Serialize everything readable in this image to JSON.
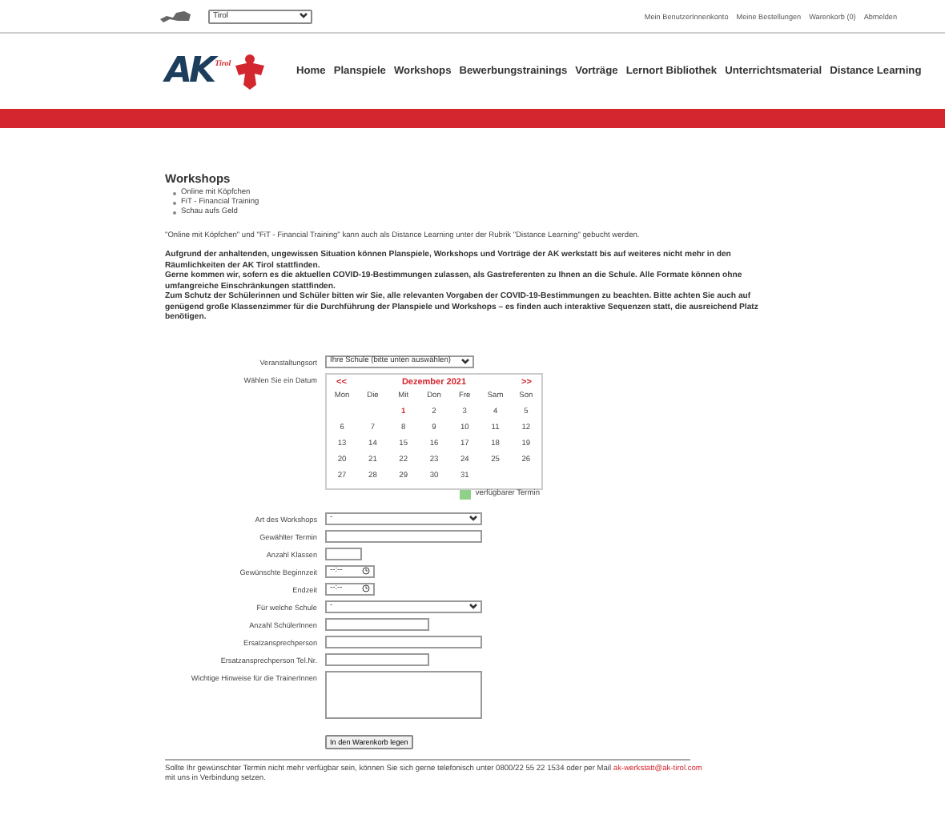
{
  "top_bar": {
    "region_select": {
      "value": "Tirol"
    },
    "links": [
      "Mein BenutzerInnenkonto",
      "Meine Bestellungen",
      "Warenkorb (0)",
      "Abmelden"
    ]
  },
  "logo": {
    "letters": "AK",
    "sub": "Tirol"
  },
  "nav": [
    "Home",
    "Planspiele",
    "Workshops",
    "Bewerbungstrainings",
    "Vorträge",
    "Lernort Bibliothek",
    "Unterrichtsmaterial",
    "Distance Learning"
  ],
  "heading": "Workshops",
  "workshops": [
    "Online mit Köpfchen",
    "FiT - Financial Training",
    "Schau aufs Geld"
  ],
  "note": "\"Online mit Köpfchen\" und \"FiT - Financial Training\" kann auch als Distance Learning unter der Rubrik \"Distance Learning\" gebucht werden.",
  "notice": [
    "Aufgrund der anhaltenden, ungewissen Situation können Planspiele, Workshops und Vorträge der AK werkstatt bis auf weiteres nicht mehr in den Räumlichkeiten der AK Tirol stattfinden.",
    "Gerne kommen wir, sofern es die aktuellen COVID-19-Bestimmungen zulassen, als Gastreferenten zu Ihnen an die Schule. Alle Formate können ohne umfangreiche Einschränkungen stattfinden.",
    "Zum Schutz der Schülerinnen und Schüler bitten wir Sie, alle relevanten Vorgaben der COVID-19-Bestimmungen zu beachten. Bitte achten Sie auch auf genügend große Klassenzimmer für die Durchführung der Planspiele und Workshops – es finden auch interaktive Sequenzen statt, die ausreichend Platz benötigen."
  ],
  "venue": {
    "label": "Veranstaltungsort",
    "value": "Ihre Schule (bitte unten auswählen)"
  },
  "date_label": "Wählen Sie ein Datum",
  "calendar": {
    "prev": "<<",
    "month": "Dezember 2021",
    "next": ">>",
    "weekdays": [
      "Mon",
      "Die",
      "Mit",
      "Don",
      "Fre",
      "Sam",
      "Son"
    ],
    "weeks": [
      [
        {
          "kind": "blank"
        },
        {
          "kind": "blank"
        },
        {
          "kind": "day",
          "day": "1",
          "highlighted": true
        },
        {
          "kind": "day",
          "day": "2",
          "highlighted": false
        },
        {
          "kind": "day",
          "day": "3",
          "highlighted": false
        },
        {
          "kind": "day",
          "day": "4",
          "highlighted": false
        },
        {
          "kind": "day",
          "day": "5",
          "highlighted": false
        }
      ],
      [
        {
          "kind": "day",
          "day": "6",
          "highlighted": false
        },
        {
          "kind": "day",
          "day": "7",
          "highlighted": false
        },
        {
          "kind": "day",
          "day": "8",
          "highlighted": false
        },
        {
          "kind": "day",
          "day": "9",
          "highlighted": false
        },
        {
          "kind": "day",
          "day": "10",
          "highlighted": false
        },
        {
          "kind": "day",
          "day": "11",
          "highlighted": false
        },
        {
          "kind": "day",
          "day": "12",
          "highlighted": false
        }
      ],
      [
        {
          "kind": "day",
          "day": "13",
          "highlighted": false
        },
        {
          "kind": "day",
          "day": "14",
          "highlighted": false
        },
        {
          "kind": "day",
          "day": "15",
          "highlighted": false
        },
        {
          "kind": "day",
          "day": "16",
          "highlighted": false
        },
        {
          "kind": "day",
          "day": "17",
          "highlighted": false
        },
        {
          "kind": "day",
          "day": "18",
          "highlighted": false
        },
        {
          "kind": "day",
          "day": "19",
          "highlighted": false
        }
      ],
      [
        {
          "kind": "day",
          "day": "20",
          "highlighted": false
        },
        {
          "kind": "day",
          "day": "21",
          "highlighted": false
        },
        {
          "kind": "day",
          "day": "22",
          "highlighted": false
        },
        {
          "kind": "day",
          "day": "23",
          "highlighted": false
        },
        {
          "kind": "day",
          "day": "24",
          "highlighted": false
        },
        {
          "kind": "day",
          "day": "25",
          "highlighted": false
        },
        {
          "kind": "day",
          "day": "26",
          "highlighted": false
        }
      ],
      [
        {
          "kind": "day",
          "day": "27",
          "highlighted": false
        },
        {
          "kind": "day",
          "day": "28",
          "highlighted": false
        },
        {
          "kind": "day",
          "day": "29",
          "highlighted": false
        },
        {
          "kind": "day",
          "day": "30",
          "highlighted": false
        },
        {
          "kind": "day",
          "day": "31",
          "highlighted": false
        },
        {
          "kind": "blank"
        },
        {
          "kind": "blank"
        }
      ]
    ],
    "legend": {
      "label": "verfügbarer Termin",
      "color": "#8fd18a"
    }
  },
  "fields": [
    {
      "label": "Art des Workshops",
      "kind": "select",
      "value": "-"
    },
    {
      "label": "Gewählter Termin",
      "kind": "text"
    },
    {
      "label": "Anzahl Klassen",
      "kind": "text"
    },
    {
      "label": "Gewünschte Beginnzeit",
      "kind": "time",
      "value": "--:--"
    },
    {
      "label": "Endzeit",
      "kind": "time",
      "value": "--:--"
    },
    {
      "label": "Für welche Schule",
      "kind": "select",
      "value": "-"
    },
    {
      "label": "Anzahl SchülerInnen",
      "kind": "text"
    },
    {
      "label": "Ersatzansprechperson",
      "kind": "text"
    },
    {
      "label": "Ersatzansprechperson Tel.Nr.",
      "kind": "text"
    },
    {
      "label": "Wichtige Hinweise für die TrainerInnen",
      "kind": "textarea"
    }
  ],
  "submit": "In den Warenkorb legen",
  "footer": {
    "text": "Sollte Ihr gewünschter Termin nicht mehr verfügbar sein, können Sie sich gerne telefonisch unter 0800/22 55 22 1534 oder per Mail",
    "email": "ak-werkstatt@ak-tirol.com",
    "rest": "mit uns in Verbindung setzen."
  }
}
